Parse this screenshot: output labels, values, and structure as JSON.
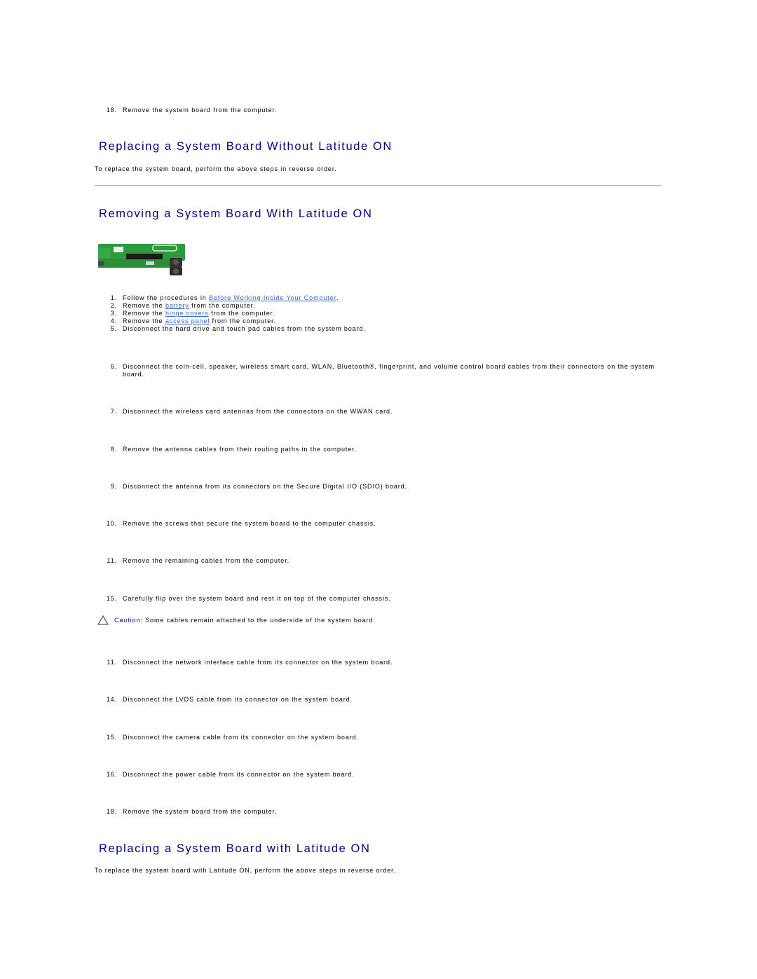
{
  "colors": {
    "heading": "#000080",
    "link": "#3366cc",
    "caution_label": "#000080",
    "text": "#000000"
  },
  "top_step": {
    "number": "18.",
    "text": "Remove the system board from the computer."
  },
  "section_replace_without": {
    "title": "Replacing a System Board Without Latitude ON",
    "body": "To replace the system board, perform the above steps in reverse order."
  },
  "section_remove_with": {
    "title": "Removing a System Board With Latitude ON",
    "image_alt": "system-board-photo",
    "steps": [
      {
        "number": "1.",
        "pre": "Follow the procedures in ",
        "link": "Before Working Inside Your Computer",
        "post": "."
      },
      {
        "number": "2.",
        "pre": "Remove the ",
        "link": "battery",
        "post": " from the computer."
      },
      {
        "number": "3.",
        "pre": "Remove the ",
        "link": "hinge covers",
        "post": " from the computer."
      },
      {
        "number": "4.",
        "pre": "Remove the ",
        "link": "access panel",
        "post": " from the computer."
      },
      {
        "number": "5.",
        "text": "Disconnect the hard drive and touch pad cables from the system board."
      },
      {
        "number": "6.",
        "text": "Disconnect the coin-cell, speaker, wireless smart card, WLAN, Bluetooth®, fingerprint, and volume control board cables from their connectors on the system board."
      },
      {
        "number": "7.",
        "text": "Disconnect the wireless card antennas from the connectors on the WWAN card."
      },
      {
        "number": "8.",
        "text": "Remove the antenna cables from their routing paths in the computer."
      },
      {
        "number": "9.",
        "text": "Disconnect the antenna from its connectors on the Secure Digital I/O (SDIO) board."
      },
      {
        "number": "10.",
        "text": "Remove the screws that secure the system board to the computer chassis."
      },
      {
        "number": "11.",
        "text": "Remove the remaining cables from the computer."
      },
      {
        "number": "15.",
        "text": "Carefully flip over the system board and rest it on top of the computer chassis."
      }
    ],
    "caution": {
      "icon": "caution-triangle-icon",
      "label": "Caution:",
      "text": " Some cables remain attached to the underside of the system board."
    },
    "steps_after": [
      {
        "number": "11.",
        "text": "Disconnect the network interface cable from its connector on the system board."
      },
      {
        "number": "14.",
        "text": "Disconnect the LVDS cable from its connector on the system board."
      },
      {
        "number": "15.",
        "text": "Disconnect the camera cable from its connector on the system board."
      },
      {
        "number": "16.",
        "text": "Disconnect the power cable from its connector on the system board."
      },
      {
        "number": "18.",
        "text": "Remove the system board from the computer."
      }
    ]
  },
  "section_replace_with": {
    "title": "Replacing a System Board with Latitude ON",
    "body": "To replace the system board with Latitude ON, perform the above steps in reverse order."
  }
}
